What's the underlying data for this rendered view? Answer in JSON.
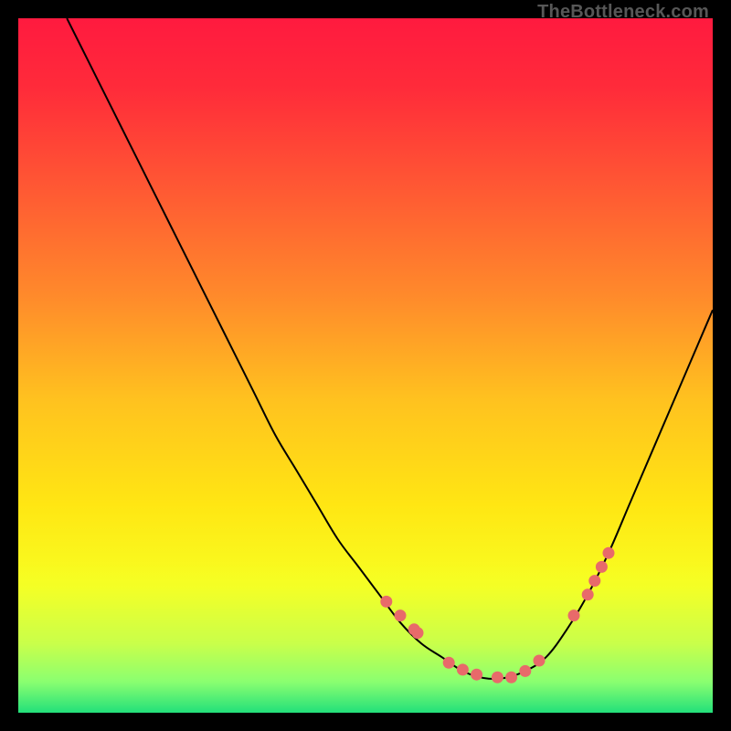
{
  "watermark": "TheBottleneck.com",
  "chart_data": {
    "type": "line",
    "title": "",
    "xlabel": "",
    "ylabel": "",
    "xlim": [
      0,
      100
    ],
    "ylim": [
      0,
      100
    ],
    "grid": false,
    "series": [
      {
        "name": "bottleneck-curve",
        "x": [
          7,
          10,
          13,
          16,
          19,
          22,
          25,
          28,
          31,
          34,
          37,
          40,
          43,
          46,
          49,
          52,
          55,
          58,
          61,
          64,
          67,
          70,
          73,
          76,
          79,
          82,
          85,
          88,
          91,
          94,
          97,
          100
        ],
        "y": [
          100,
          94,
          88,
          82,
          76,
          70,
          64,
          58,
          52,
          46,
          40,
          35,
          30,
          25,
          21,
          17,
          13,
          10,
          8,
          6,
          5,
          5,
          6,
          8,
          12,
          17,
          23,
          30,
          37,
          44,
          51,
          58
        ]
      }
    ],
    "points": {
      "name": "dot-markers",
      "x": [
        53,
        55,
        57,
        57.5,
        62,
        64,
        66,
        69,
        71,
        73,
        75,
        80,
        82,
        83,
        84,
        85
      ],
      "y": [
        16,
        14,
        12,
        11.5,
        7.2,
        6.2,
        5.5,
        5.1,
        5.1,
        6.0,
        7.5,
        14,
        17,
        19,
        21,
        23
      ]
    },
    "gradient_stops": [
      {
        "offset": 0.0,
        "color": "#ff1a3f"
      },
      {
        "offset": 0.1,
        "color": "#ff2b3a"
      },
      {
        "offset": 0.25,
        "color": "#ff5a33"
      },
      {
        "offset": 0.4,
        "color": "#ff8a2b"
      },
      {
        "offset": 0.55,
        "color": "#ffc21f"
      },
      {
        "offset": 0.7,
        "color": "#ffe613"
      },
      {
        "offset": 0.82,
        "color": "#f7ff22"
      },
      {
        "offset": 0.9,
        "color": "#c9ff4a"
      },
      {
        "offset": 0.95,
        "color": "#8bff70"
      },
      {
        "offset": 1.0,
        "color": "#22e07a"
      }
    ],
    "band": {
      "top": 0.78,
      "bottom": 1.0
    },
    "marker_color": "#e86a6a",
    "curve_color": "#000000"
  }
}
